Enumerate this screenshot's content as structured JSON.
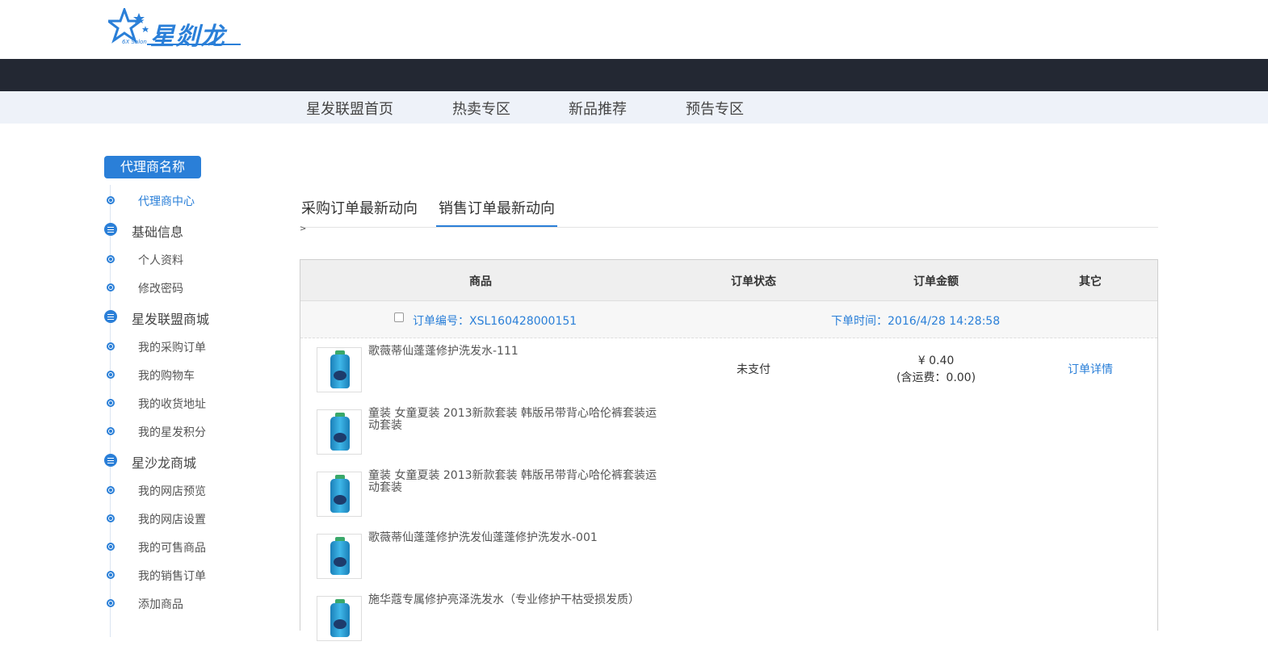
{
  "brand": {
    "logo_text": "星剡龙",
    "logo_sub": "6X Salon",
    "accent": "#2a7fd8"
  },
  "nav": {
    "items": [
      "星发联盟首页",
      "热卖专区",
      "新品推荐",
      "预告专区"
    ]
  },
  "sidebar": {
    "title": "代理商名称",
    "center": "代理商中心",
    "groups": [
      {
        "label": "基础信息",
        "items": [
          "个人资料",
          "修改密码"
        ]
      },
      {
        "label": "星发联盟商城",
        "items": [
          "我的采购订单",
          "我的购物车",
          "我的收货地址",
          "我的星发积分"
        ]
      },
      {
        "label": "星沙龙商城",
        "items": [
          "我的网店预览",
          "我的网店设置",
          "我的可售商品",
          "我的销售订单",
          "添加商品"
        ]
      }
    ]
  },
  "tabs": [
    "采购订单最新动向",
    "销售订单最新动向"
  ],
  "active_tab": 1,
  "breadcrumb": ">",
  "table": {
    "headers": [
      "商品",
      "订单状态",
      "订单金额",
      "其它"
    ],
    "order": {
      "number": "订单编号：XSL160428000151",
      "time": "下单时间：2016/4/28 14:28:58",
      "status": "未支付",
      "price": "¥ 0.40",
      "shipping": "(含运费：0.00)",
      "action": "订单详情",
      "items": [
        "歌薇蒂仙蓬蓬修护洗发水-111",
        "童装 女童夏装 2013新款套装 韩版吊带背心哈伦裤套装运动套装",
        "童装 女童夏装 2013新款套装 韩版吊带背心哈伦裤套装运动套装",
        "歌薇蒂仙蓬蓬修护洗发仙蓬蓬修护洗发水-001",
        "施华蔻专属修护亮泽洗发水（专业修护干枯受损发质）"
      ]
    }
  }
}
